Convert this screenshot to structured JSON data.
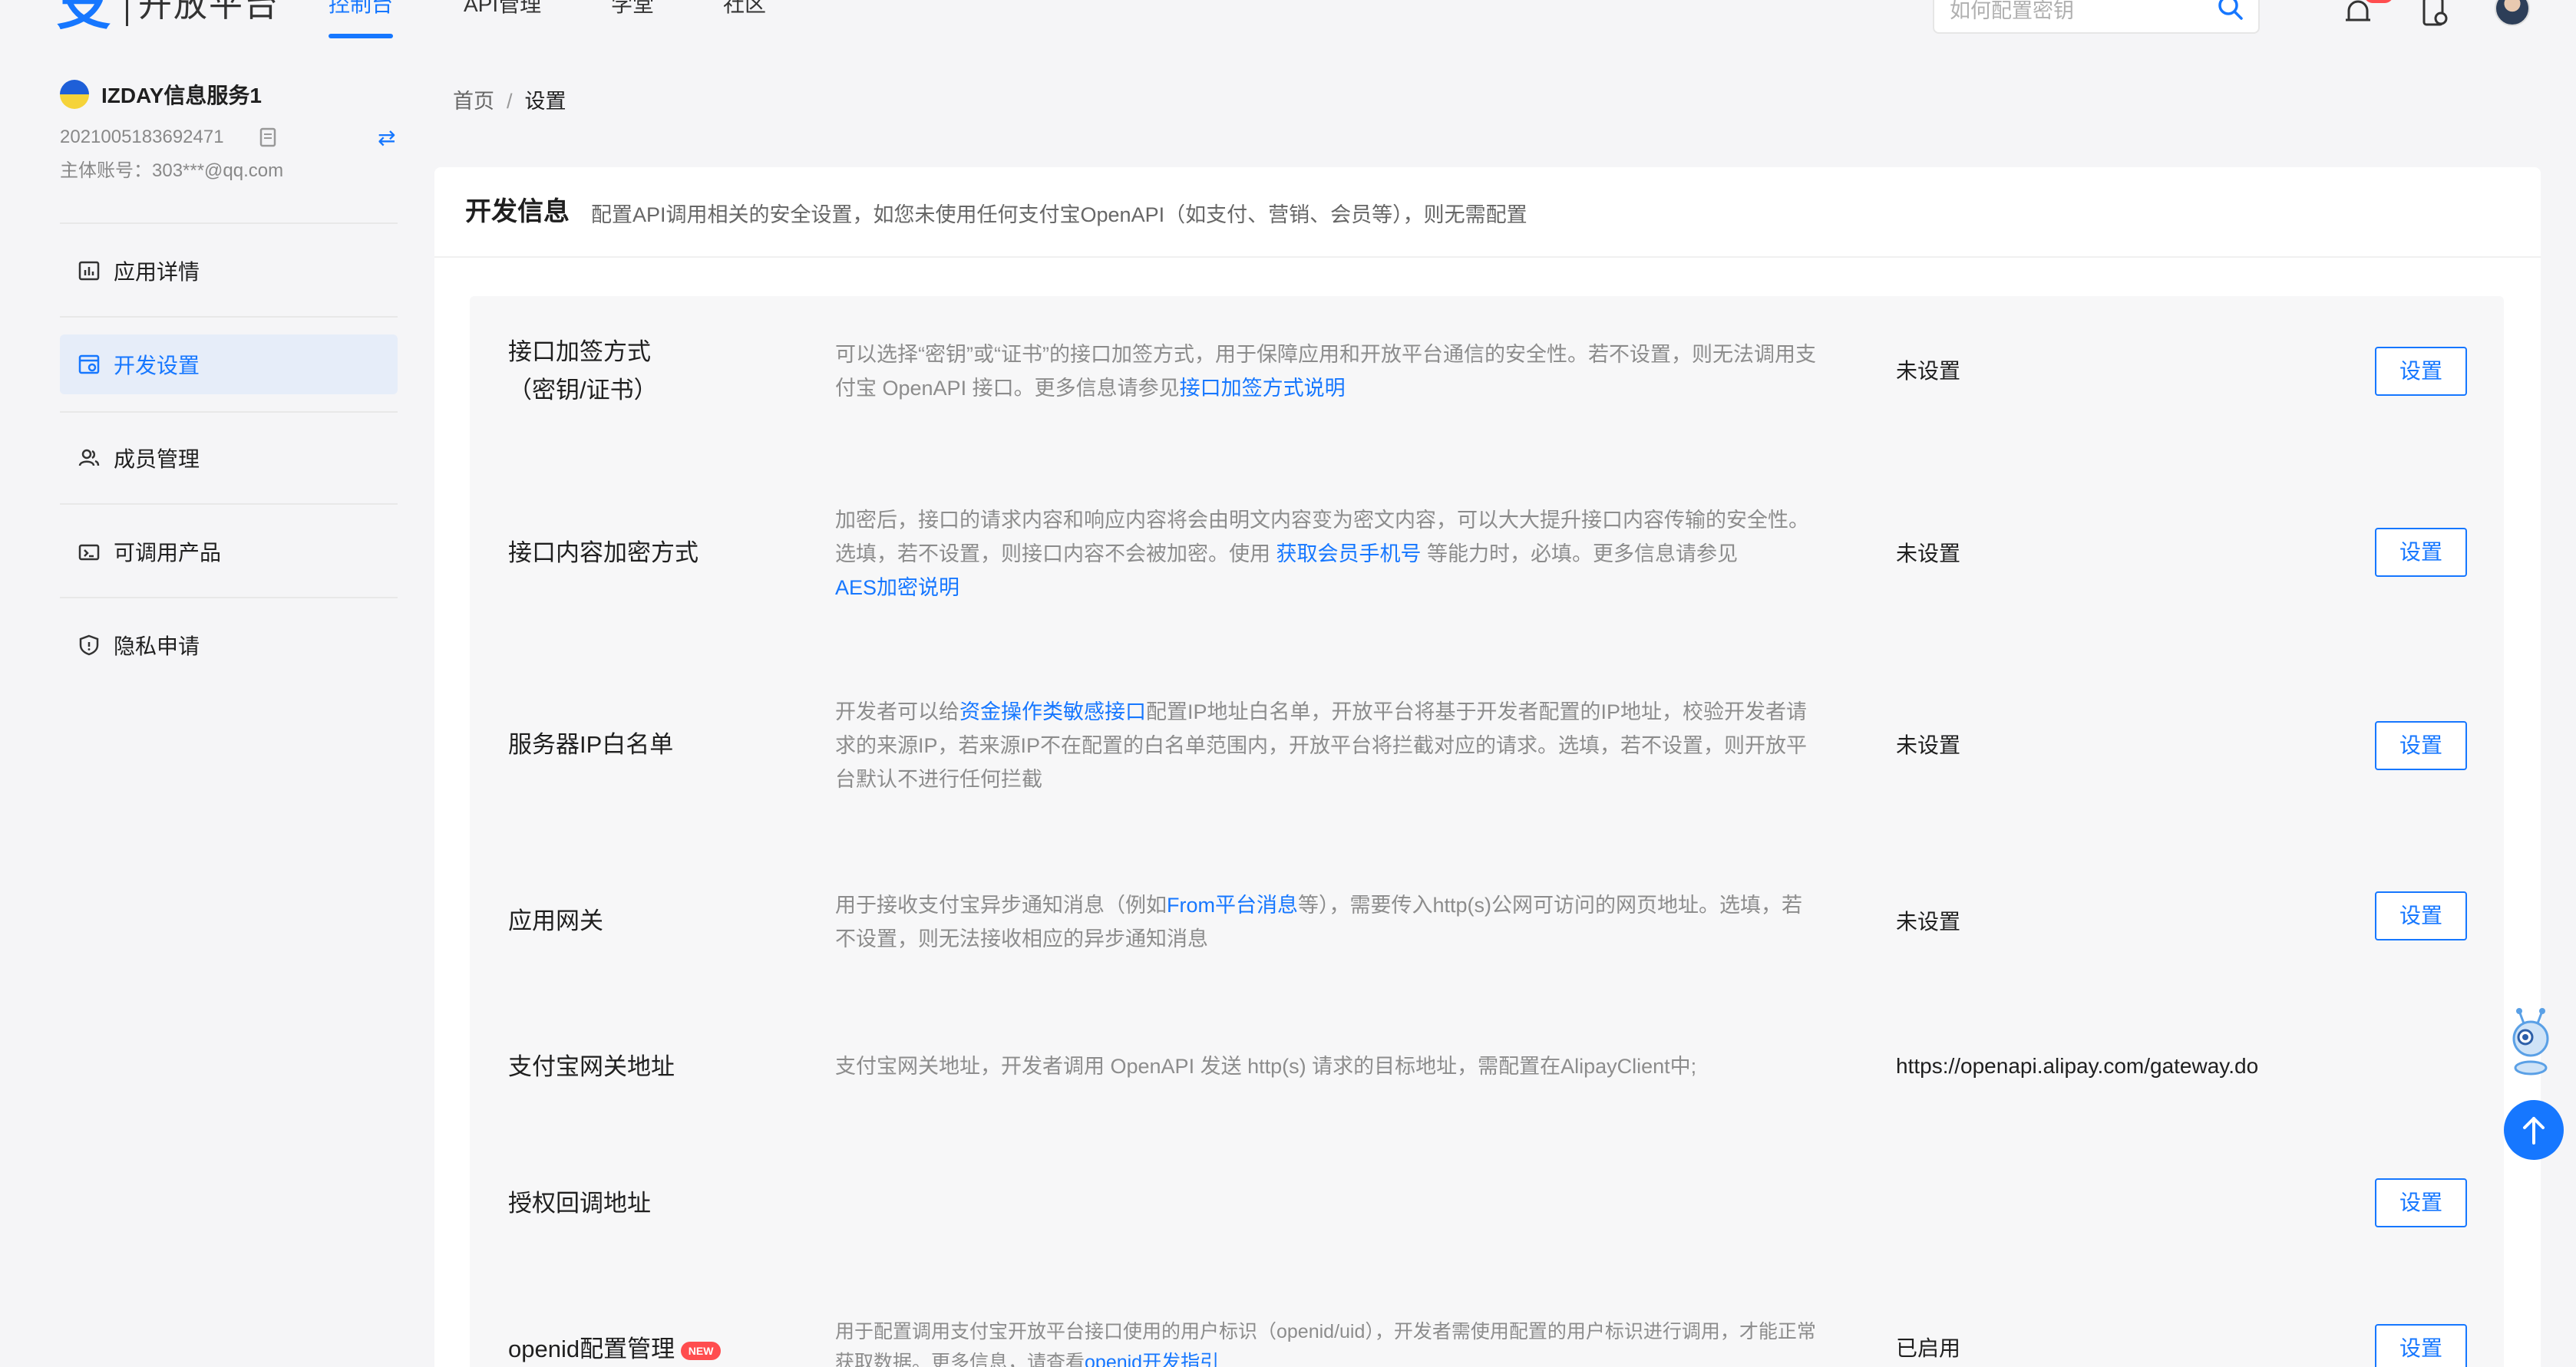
{
  "header": {
    "logo_text": "开放平台",
    "nav": [
      "控制台",
      "API管理",
      "学堂",
      "社区"
    ],
    "search": {
      "placeholder": "如何配置密钥"
    }
  },
  "sidebar": {
    "app_name": "IZDAY信息服务1",
    "app_id": "2021005183692471",
    "owner": "主体账号：303***@qq.com",
    "items": [
      {
        "label": "应用详情",
        "icon": "chart-icon"
      },
      {
        "label": "开发设置",
        "icon": "dev-settings-icon",
        "active": true
      },
      {
        "label": "成员管理",
        "icon": "members-icon"
      },
      {
        "label": "可调用产品",
        "icon": "products-icon"
      },
      {
        "label": "隐私申请",
        "icon": "shield-icon"
      }
    ]
  },
  "breadcrumb": {
    "home": "首页",
    "sep": "/",
    "current": "设置"
  },
  "section": {
    "title": "开发信息",
    "desc": "配置API调用相关的安全设置，如您未使用任何支付宝OpenAPI（如支付、营销、会员等），则无需配置"
  },
  "rows": [
    {
      "title_l1": "接口加签方式",
      "title_l2": "（密钥/证书）",
      "desc_a": "可以选择“密钥”或“证书”的接口加签方式，用于保障应用和开放平台通信的安全性。若不设置，则无法调用支付宝 OpenAPI 接口。更多信息请参见",
      "desc_link": "接口加签方式说明",
      "status": "未设置",
      "button": "设置"
    },
    {
      "title": "接口内容加密方式",
      "desc_a": "加密后，接口的请求内容和响应内容将会由明文内容变为密文内容，可以大大提升接口内容传输的安全性。选填，若不设置，则接口内容不会被加密。使用 ",
      "desc_link": "获取会员手机号",
      "desc_b": " 等能力时，必填。更多信息请参见",
      "desc_link2": "AES加密说明",
      "status": "未设置",
      "button": "设置"
    },
    {
      "title": "服务器IP白名单",
      "desc_a": "开发者可以给",
      "desc_link": "资金操作类敏感接口",
      "desc_b": "配置IP地址白名单，开放平台将基于开发者配置的IP地址，校验开发者请求的来源IP，若来源IP不在配置的白名单范围内，开放平台将拦截对应的请求。选填，若不设置，则开放平台默认不进行任何拦截",
      "status": "未设置",
      "button": "设置"
    },
    {
      "title": "应用网关",
      "desc_a": "用于接收支付宝异步通知消息（例如",
      "desc_link": "From平台消息",
      "desc_b": "等），需要传入http(s)公网可访问的网页地址。选填，若不设置，则无法接收相应的异步通知消息",
      "status": "未设置",
      "button": "设置"
    },
    {
      "title": "支付宝网关地址",
      "desc_a": "支付宝网关地址，开发者调用 OpenAPI 发送 http(s) 请求的目标地址，需配置在AlipayClient中;",
      "status": "https://openapi.alipay.com/gateway.do"
    },
    {
      "title": "授权回调地址",
      "button": "设置"
    },
    {
      "title": "openid配置管理",
      "badge": "NEW",
      "desc_a": "用于配置调用支付宝开放平台接口使用的用户标识（openid/uid），开发者需使用配置的用户标识进行调用，才能正常获取数据。更多信息，请查看",
      "desc_link": "openid开发指引",
      "status": "已启用",
      "button": "设置"
    }
  ]
}
